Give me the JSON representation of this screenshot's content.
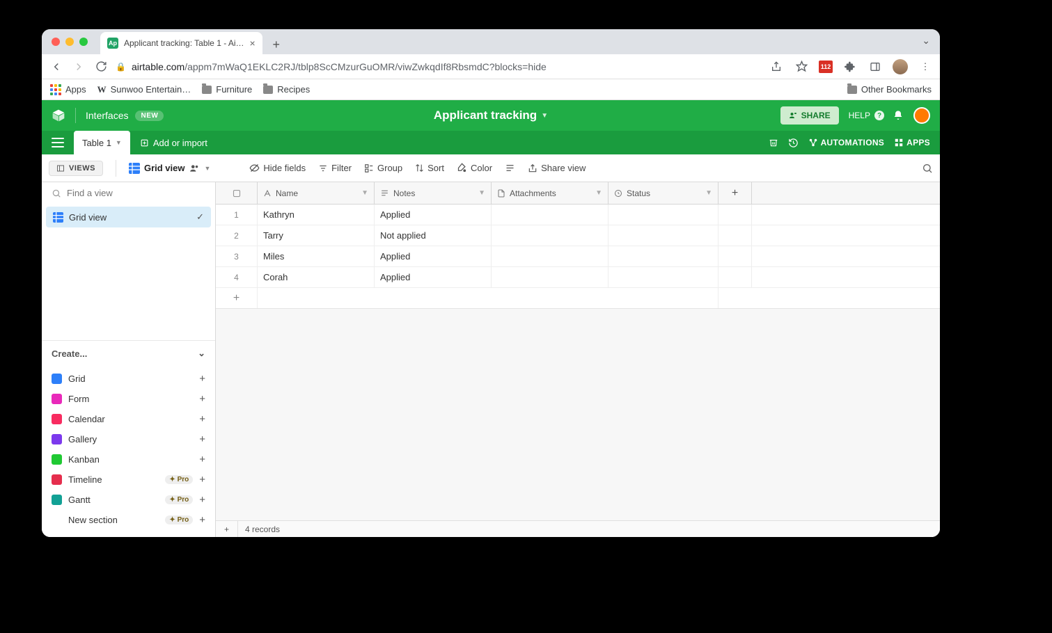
{
  "browser": {
    "tab_title": "Applicant tracking: Table 1 - Ai…",
    "tab_favicon_text": "Ap",
    "url_domain": "airtable.com",
    "url_path": "/appm7mWaQ1EKLC2RJ/tblp8ScCMzurGuOMR/viwZwkqdIf8RbsmdC?blocks=hide",
    "ext_badge": "112",
    "bookmarks": {
      "apps": "Apps",
      "items": [
        "Sunwoo Entertain…",
        "Furniture",
        "Recipes"
      ],
      "other": "Other Bookmarks"
    }
  },
  "header": {
    "interfaces": "Interfaces",
    "new_badge": "NEW",
    "base_name": "Applicant tracking",
    "share": "SHARE",
    "help": "HELP",
    "automations": "AUTOMATIONS",
    "apps": "APPS"
  },
  "tablebar": {
    "table1": "Table 1",
    "add_or_import": "Add or import"
  },
  "toolbar": {
    "views": "VIEWS",
    "grid_view": "Grid view",
    "hide_fields": "Hide fields",
    "filter": "Filter",
    "group": "Group",
    "sort": "Sort",
    "color": "Color",
    "share_view": "Share view"
  },
  "sidebar": {
    "find_placeholder": "Find a view",
    "current_view": "Grid view",
    "create_header": "Create...",
    "creates": [
      {
        "label": "Grid",
        "color": "#2d7ff9"
      },
      {
        "label": "Form",
        "color": "#e929ba"
      },
      {
        "label": "Calendar",
        "color": "#f82b60"
      },
      {
        "label": "Gallery",
        "color": "#7c39ed"
      },
      {
        "label": "Kanban",
        "color": "#20c933"
      },
      {
        "label": "Timeline",
        "color": "#e52e4d",
        "pro": true
      },
      {
        "label": "Gantt",
        "color": "#12a195",
        "pro": true
      },
      {
        "label": "New section",
        "color": "",
        "pro": true
      }
    ],
    "pro_label": "Pro"
  },
  "table": {
    "columns": [
      "Name",
      "Notes",
      "Attachments",
      "Status"
    ],
    "rows": [
      {
        "n": "1",
        "name": "Kathryn",
        "notes": "Applied",
        "att": "",
        "status": ""
      },
      {
        "n": "2",
        "name": "Tarry",
        "notes": "Not applied",
        "att": "",
        "status": ""
      },
      {
        "n": "3",
        "name": "Miles",
        "notes": "Applied",
        "att": "",
        "status": ""
      },
      {
        "n": "4",
        "name": "Corah",
        "notes": "Applied",
        "att": "",
        "status": ""
      }
    ],
    "footer": "4 records"
  }
}
